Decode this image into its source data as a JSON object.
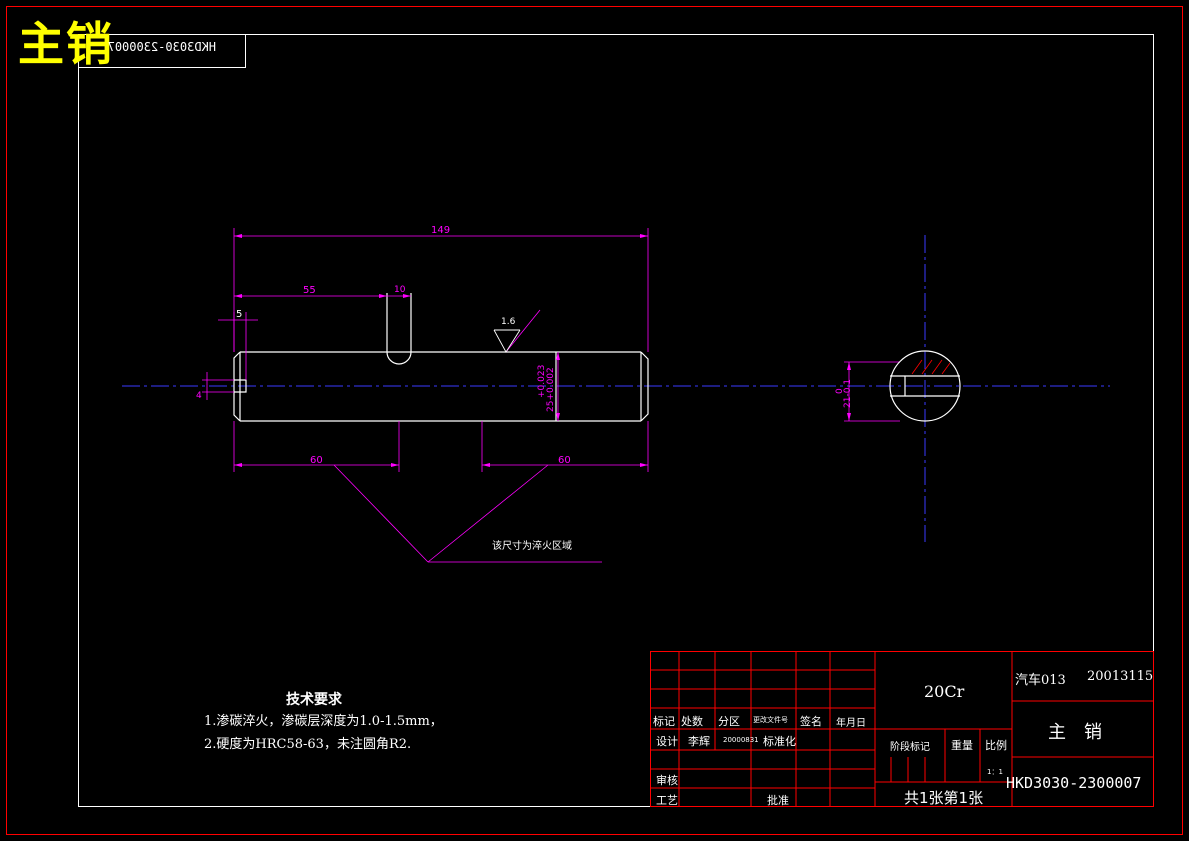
{
  "drawing": {
    "title_large": "主销",
    "code_mirrored": "HKD3030-2300007"
  },
  "dimensions": {
    "overall_length": "149",
    "d55": "55",
    "d10": "10",
    "d5": "5",
    "d4": "4",
    "d60_left": "60",
    "d60_right": "60",
    "roughness": "1.6",
    "tolerance_upper": "+0.023",
    "tolerance_main": "25+0.002",
    "section_zero": "0",
    "section_dim": "21-0.1",
    "quench_note": "该尺寸为淬火区域"
  },
  "requirements": {
    "heading": "技术要求",
    "item1": "1.渗碳淬火，渗碳层深度为1.0-1.5mm，",
    "item2": "2.硬度为HRC58-63，未注圆角R2."
  },
  "title_block": {
    "material": "20Cr",
    "course": "汽车013",
    "student_no": "20013115",
    "part_name": "主　销",
    "drawing_no": "HKD3030-2300007",
    "sheets": "共1张第1张",
    "h_mark": "标记",
    "h_count": "处数",
    "h_zone": "分区",
    "h_change_doc": "更改文件号",
    "h_sign": "签名",
    "h_date": "年月日",
    "h_design": "设计",
    "designer": "李辉",
    "design_date": "20000831",
    "h_standard": "标准化",
    "h_stage": "阶段标记",
    "h_weight": "重量",
    "h_scale": "比例",
    "scale": "1：1",
    "h_review": "审核",
    "h_process": "工艺",
    "h_approve": "批准"
  }
}
